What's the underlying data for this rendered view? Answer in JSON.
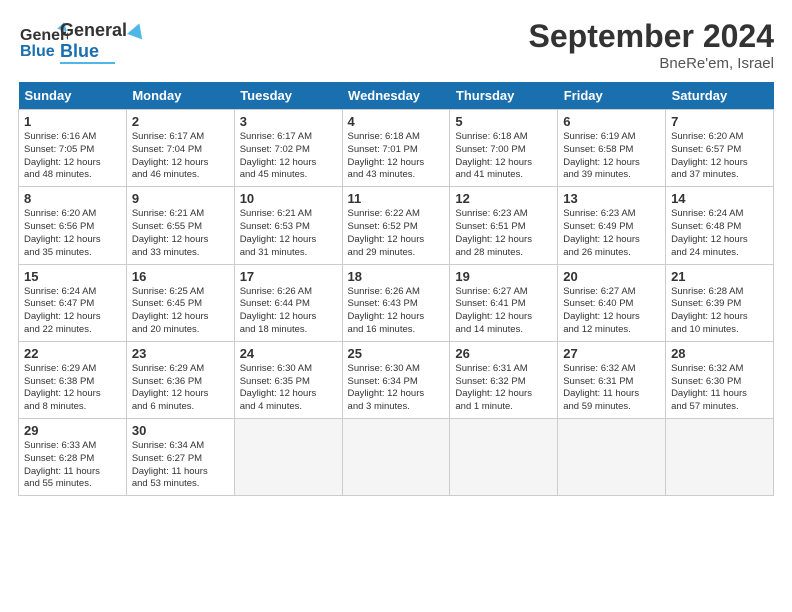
{
  "header": {
    "logo_line1": "General",
    "logo_line2": "Blue",
    "month": "September 2024",
    "location": "BneRe'em, Israel"
  },
  "weekdays": [
    "Sunday",
    "Monday",
    "Tuesday",
    "Wednesday",
    "Thursday",
    "Friday",
    "Saturday"
  ],
  "weeks": [
    [
      {
        "day": 1,
        "info": "Sunrise: 6:16 AM\nSunset: 7:05 PM\nDaylight: 12 hours\nand 48 minutes."
      },
      {
        "day": 2,
        "info": "Sunrise: 6:17 AM\nSunset: 7:04 PM\nDaylight: 12 hours\nand 46 minutes."
      },
      {
        "day": 3,
        "info": "Sunrise: 6:17 AM\nSunset: 7:02 PM\nDaylight: 12 hours\nand 45 minutes."
      },
      {
        "day": 4,
        "info": "Sunrise: 6:18 AM\nSunset: 7:01 PM\nDaylight: 12 hours\nand 43 minutes."
      },
      {
        "day": 5,
        "info": "Sunrise: 6:18 AM\nSunset: 7:00 PM\nDaylight: 12 hours\nand 41 minutes."
      },
      {
        "day": 6,
        "info": "Sunrise: 6:19 AM\nSunset: 6:58 PM\nDaylight: 12 hours\nand 39 minutes."
      },
      {
        "day": 7,
        "info": "Sunrise: 6:20 AM\nSunset: 6:57 PM\nDaylight: 12 hours\nand 37 minutes."
      }
    ],
    [
      {
        "day": 8,
        "info": "Sunrise: 6:20 AM\nSunset: 6:56 PM\nDaylight: 12 hours\nand 35 minutes."
      },
      {
        "day": 9,
        "info": "Sunrise: 6:21 AM\nSunset: 6:55 PM\nDaylight: 12 hours\nand 33 minutes."
      },
      {
        "day": 10,
        "info": "Sunrise: 6:21 AM\nSunset: 6:53 PM\nDaylight: 12 hours\nand 31 minutes."
      },
      {
        "day": 11,
        "info": "Sunrise: 6:22 AM\nSunset: 6:52 PM\nDaylight: 12 hours\nand 29 minutes."
      },
      {
        "day": 12,
        "info": "Sunrise: 6:23 AM\nSunset: 6:51 PM\nDaylight: 12 hours\nand 28 minutes."
      },
      {
        "day": 13,
        "info": "Sunrise: 6:23 AM\nSunset: 6:49 PM\nDaylight: 12 hours\nand 26 minutes."
      },
      {
        "day": 14,
        "info": "Sunrise: 6:24 AM\nSunset: 6:48 PM\nDaylight: 12 hours\nand 24 minutes."
      }
    ],
    [
      {
        "day": 15,
        "info": "Sunrise: 6:24 AM\nSunset: 6:47 PM\nDaylight: 12 hours\nand 22 minutes."
      },
      {
        "day": 16,
        "info": "Sunrise: 6:25 AM\nSunset: 6:45 PM\nDaylight: 12 hours\nand 20 minutes."
      },
      {
        "day": 17,
        "info": "Sunrise: 6:26 AM\nSunset: 6:44 PM\nDaylight: 12 hours\nand 18 minutes."
      },
      {
        "day": 18,
        "info": "Sunrise: 6:26 AM\nSunset: 6:43 PM\nDaylight: 12 hours\nand 16 minutes."
      },
      {
        "day": 19,
        "info": "Sunrise: 6:27 AM\nSunset: 6:41 PM\nDaylight: 12 hours\nand 14 minutes."
      },
      {
        "day": 20,
        "info": "Sunrise: 6:27 AM\nSunset: 6:40 PM\nDaylight: 12 hours\nand 12 minutes."
      },
      {
        "day": 21,
        "info": "Sunrise: 6:28 AM\nSunset: 6:39 PM\nDaylight: 12 hours\nand 10 minutes."
      }
    ],
    [
      {
        "day": 22,
        "info": "Sunrise: 6:29 AM\nSunset: 6:38 PM\nDaylight: 12 hours\nand 8 minutes."
      },
      {
        "day": 23,
        "info": "Sunrise: 6:29 AM\nSunset: 6:36 PM\nDaylight: 12 hours\nand 6 minutes."
      },
      {
        "day": 24,
        "info": "Sunrise: 6:30 AM\nSunset: 6:35 PM\nDaylight: 12 hours\nand 4 minutes."
      },
      {
        "day": 25,
        "info": "Sunrise: 6:30 AM\nSunset: 6:34 PM\nDaylight: 12 hours\nand 3 minutes."
      },
      {
        "day": 26,
        "info": "Sunrise: 6:31 AM\nSunset: 6:32 PM\nDaylight: 12 hours\nand 1 minute."
      },
      {
        "day": 27,
        "info": "Sunrise: 6:32 AM\nSunset: 6:31 PM\nDaylight: 11 hours\nand 59 minutes."
      },
      {
        "day": 28,
        "info": "Sunrise: 6:32 AM\nSunset: 6:30 PM\nDaylight: 11 hours\nand 57 minutes."
      }
    ],
    [
      {
        "day": 29,
        "info": "Sunrise: 6:33 AM\nSunset: 6:28 PM\nDaylight: 11 hours\nand 55 minutes."
      },
      {
        "day": 30,
        "info": "Sunrise: 6:34 AM\nSunset: 6:27 PM\nDaylight: 11 hours\nand 53 minutes."
      },
      null,
      null,
      null,
      null,
      null
    ]
  ]
}
